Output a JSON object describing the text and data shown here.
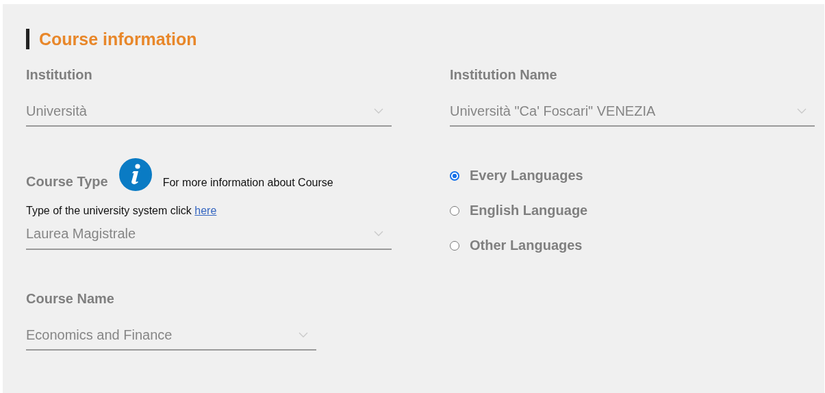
{
  "section": {
    "title": "Course information"
  },
  "institution": {
    "label": "Institution",
    "value": "Università"
  },
  "institution_name": {
    "label": "Institution Name",
    "value": "Università \"Ca' Foscari\" VENEZIA"
  },
  "course_type": {
    "label": "Course Type",
    "info_text": "For more information about Course",
    "hint_text": "Type of the university system click",
    "hint_link": "here",
    "value": "Laurea Magistrale"
  },
  "language_options": [
    {
      "label": "Every Languages",
      "selected": true
    },
    {
      "label": "English Language",
      "selected": false
    },
    {
      "label": "Other Languages",
      "selected": false
    }
  ],
  "course_name": {
    "label": "Course Name",
    "value": "Economics and Finance"
  }
}
